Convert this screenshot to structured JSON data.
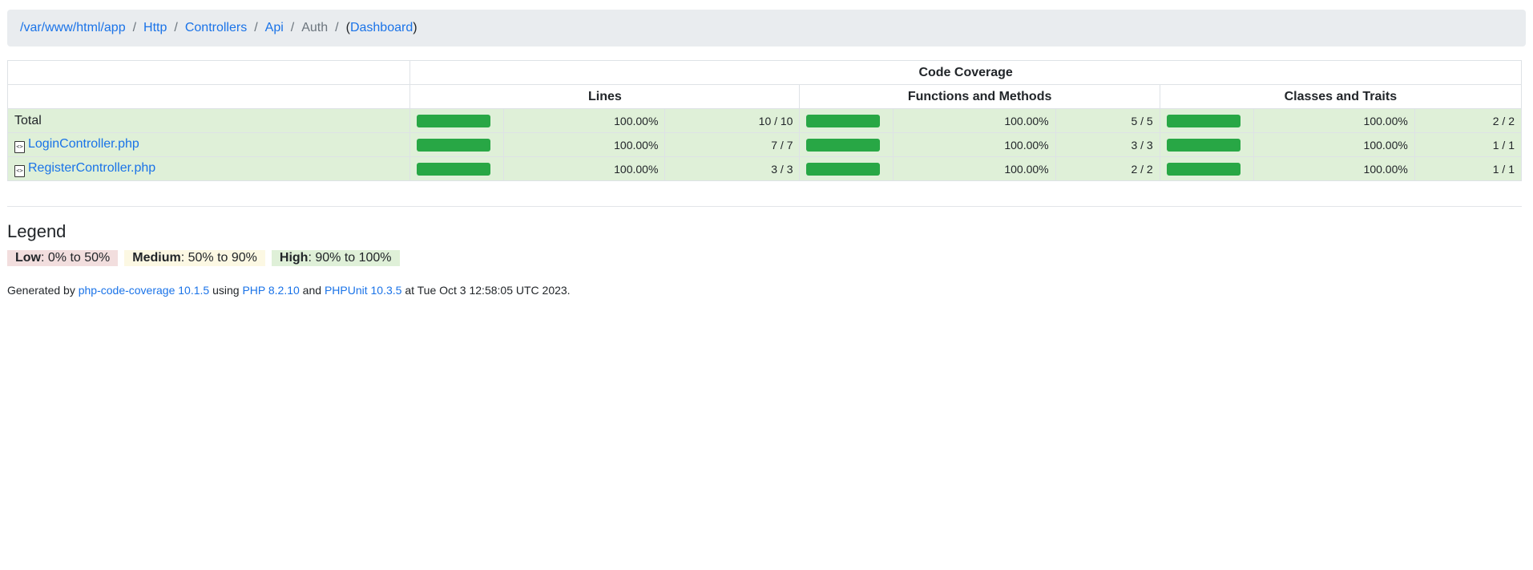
{
  "breadcrumb": {
    "items": [
      {
        "label": "/var/www/html/app",
        "link": true
      },
      {
        "label": "Http",
        "link": true
      },
      {
        "label": "Controllers",
        "link": true
      },
      {
        "label": "Api",
        "link": true
      },
      {
        "label": "Auth",
        "link": false
      }
    ],
    "separator": "/",
    "dashboard_open": "(",
    "dashboard_label": "Dashboard",
    "dashboard_close": ")"
  },
  "table": {
    "group_header": "Code Coverage",
    "columns": [
      "Lines",
      "Functions and Methods",
      "Classes and Traits"
    ],
    "rows": [
      {
        "name": "Total",
        "is_file": false,
        "lines_pct": "100.00%",
        "lines_ratio": "10 / 10",
        "functions_pct": "100.00%",
        "functions_ratio": "5 / 5",
        "classes_pct": "100.00%",
        "classes_ratio": "2 / 2"
      },
      {
        "name": "LoginController.php",
        "is_file": true,
        "lines_pct": "100.00%",
        "lines_ratio": "7 / 7",
        "functions_pct": "100.00%",
        "functions_ratio": "3 / 3",
        "classes_pct": "100.00%",
        "classes_ratio": "1 / 1"
      },
      {
        "name": "RegisterController.php",
        "is_file": true,
        "lines_pct": "100.00%",
        "lines_ratio": "3 / 3",
        "functions_pct": "100.00%",
        "functions_ratio": "2 / 2",
        "classes_pct": "100.00%",
        "classes_ratio": "1 / 1"
      }
    ]
  },
  "legend": {
    "title": "Legend",
    "low_label": "Low",
    "low_range": ": 0% to 50%",
    "medium_label": "Medium",
    "medium_range": ": 50% to 90%",
    "high_label": "High",
    "high_range": ": 90% to 100%"
  },
  "footer": {
    "prefix": "Generated by ",
    "tool_link": "php-code-coverage 10.1.5",
    "using": " using ",
    "php_link": "PHP 8.2.10",
    "and": " and ",
    "phpunit_link": "PHPUnit 10.3.5",
    "suffix": " at Tue Oct 3 12:58:05 UTC 2023."
  },
  "colors": {
    "high_bg": "#dff0d8",
    "bar_fill": "#28a745",
    "link": "#1a73e8"
  },
  "icons": {
    "file": "file-code-icon"
  }
}
